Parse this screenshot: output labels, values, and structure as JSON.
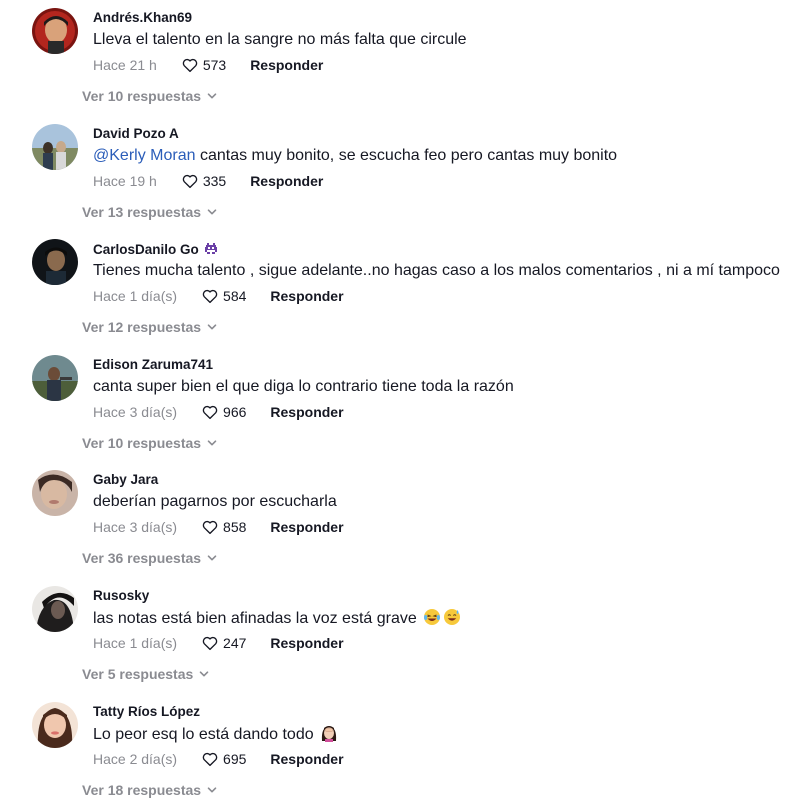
{
  "colors": {
    "text": "#161823",
    "secondary": "#8a8b91",
    "mention": "#2b5db9"
  },
  "comments": [
    {
      "username": "Andrés.Khan69",
      "text": "Lleva el talento en la sangre no más falta que circule",
      "time": "Hace 21 h",
      "likes": "573",
      "reply_label": "Responder",
      "view_replies": "Ver 10 respuestas"
    },
    {
      "username": "David Pozo A",
      "mention": "@Kerly Moran",
      "text": " cantas muy bonito, se escucha feo pero cantas muy bonito",
      "time": "Hace 19 h",
      "likes": "335",
      "reply_label": "Responder",
      "view_replies": "Ver 13 respuestas"
    },
    {
      "username": "CarlosDanilo Go",
      "username_badge_icon": "space-invader-emoji-icon",
      "text": "Tienes mucha talento , sigue adelante..no hagas caso a los malos comentarios , ni a mí tampoco",
      "time": "Hace 1 día(s)",
      "likes": "584",
      "reply_label": "Responder",
      "view_replies": "Ver 12 respuestas"
    },
    {
      "username": "Edison Zaruma741",
      "text": "canta super bien el que diga lo contrario tiene toda la razón",
      "time": "Hace 3 día(s)",
      "likes": "966",
      "reply_label": "Responder",
      "view_replies": "Ver 10 respuestas"
    },
    {
      "username": "Gaby Jara",
      "text": "deberían pagarnos por escucharla",
      "time": "Hace 3 día(s)",
      "likes": "858",
      "reply_label": "Responder",
      "view_replies": "Ver 36 respuestas"
    },
    {
      "username": "Rusosky",
      "text": "las notas está bien afinadas la voz está grave",
      "text_emoji_icons": [
        "laughing-crying-emoji-icon",
        "grinning-sweat-emoji-icon"
      ],
      "time": "Hace 1 día(s)",
      "likes": "247",
      "reply_label": "Responder",
      "view_replies": "Ver 5 respuestas"
    },
    {
      "username": "Tatty Ríos López",
      "text": "Lo peor esq lo está dando todo",
      "text_emoji_icons": [
        "woman-facepalming-emoji-icon"
      ],
      "time": "Hace 2 día(s)",
      "likes": "695",
      "reply_label": "Responder",
      "view_replies": "Ver 18 respuestas"
    }
  ]
}
